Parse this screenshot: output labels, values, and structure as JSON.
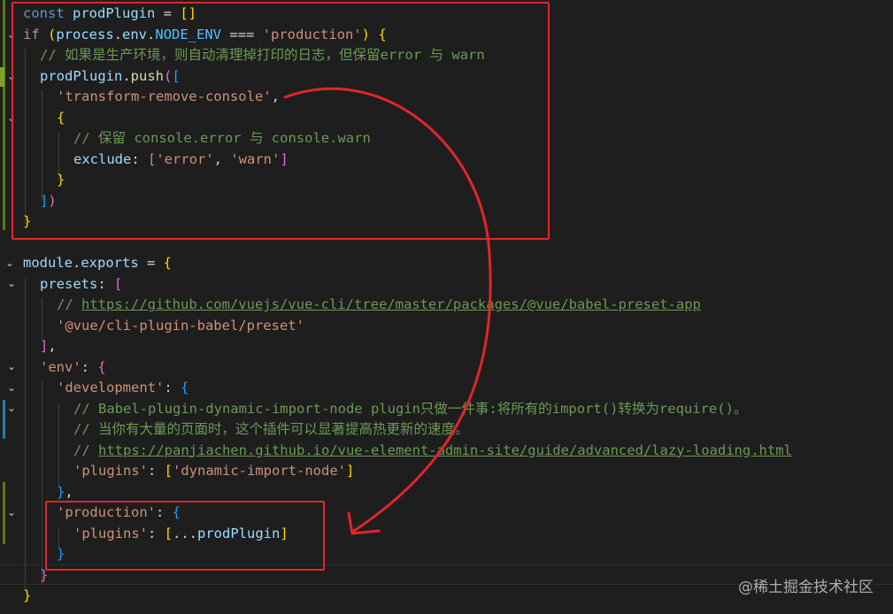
{
  "lines": [
    {
      "segments": [
        [
          "kw",
          "const "
        ],
        [
          "var",
          "prodPlugin"
        ],
        [
          "punc",
          " = "
        ],
        [
          "br1",
          "[]"
        ]
      ]
    },
    {
      "segments": [
        [
          "kw2",
          "if "
        ],
        [
          "br1",
          "("
        ],
        [
          "var",
          "process"
        ],
        [
          "punc",
          "."
        ],
        [
          "var",
          "env"
        ],
        [
          "punc",
          "."
        ],
        [
          "const",
          "NODE_ENV"
        ],
        [
          "punc",
          " === "
        ],
        [
          "str",
          "'production'"
        ],
        [
          "br1",
          ")"
        ],
        [
          "punc",
          " "
        ],
        [
          "br1",
          "{"
        ]
      ]
    },
    {
      "segments": [
        [
          "cm",
          "// 如果是生产环境，则自动清理掉打印的日志，但保留error 与 warn"
        ]
      ]
    },
    {
      "segments": [
        [
          "var",
          "prodPlugin"
        ],
        [
          "punc",
          "."
        ],
        [
          "fn",
          "push"
        ],
        [
          "br2",
          "("
        ],
        [
          "br3",
          "["
        ]
      ]
    },
    {
      "segments": [
        [
          "str",
          "'transform-remove-console'"
        ],
        [
          "punc",
          ","
        ]
      ]
    },
    {
      "segments": [
        [
          "br1",
          "{"
        ]
      ]
    },
    {
      "segments": [
        [
          "cm",
          "// 保留 console.error 与 console.warn"
        ]
      ]
    },
    {
      "segments": [
        [
          "var",
          "exclude"
        ],
        [
          "punc",
          ": "
        ],
        [
          "br2",
          "["
        ],
        [
          "str",
          "'error'"
        ],
        [
          "punc",
          ", "
        ],
        [
          "str",
          "'warn'"
        ],
        [
          "br2",
          "]"
        ]
      ]
    },
    {
      "segments": [
        [
          "br1",
          "}"
        ]
      ]
    },
    {
      "segments": [
        [
          "br3",
          "]"
        ],
        [
          "br2",
          ")"
        ]
      ]
    },
    {
      "segments": [
        [
          "br1",
          "}"
        ]
      ]
    },
    {
      "segments": []
    },
    {
      "segments": [
        [
          "var",
          "module"
        ],
        [
          "punc",
          "."
        ],
        [
          "var",
          "exports"
        ],
        [
          "punc",
          " = "
        ],
        [
          "br1",
          "{"
        ]
      ]
    },
    {
      "segments": [
        [
          "var",
          "presets"
        ],
        [
          "punc",
          ": "
        ],
        [
          "br2",
          "["
        ]
      ]
    },
    {
      "segments": [
        [
          "cm",
          "// "
        ],
        [
          "link",
          "https://github.com/vuejs/vue-cli/tree/master/packages/@vue/babel-preset-app"
        ]
      ]
    },
    {
      "segments": [
        [
          "str",
          "'@vue/cli-plugin-babel/preset'"
        ]
      ]
    },
    {
      "segments": [
        [
          "br2",
          "]"
        ],
        [
          "punc",
          ","
        ]
      ]
    },
    {
      "segments": [
        [
          "str",
          "'env'"
        ],
        [
          "punc",
          ": "
        ],
        [
          "br2",
          "{"
        ]
      ]
    },
    {
      "segments": [
        [
          "str",
          "'development'"
        ],
        [
          "punc",
          ": "
        ],
        [
          "br3",
          "{"
        ]
      ]
    },
    {
      "segments": [
        [
          "cm",
          "// Babel-plugin-dynamic-import-node plugin只做一件事:将所有的import()转换为require()。"
        ]
      ]
    },
    {
      "segments": [
        [
          "cm",
          "// 当你有大量的页面时，这个插件可以显著提高热更新的速度。"
        ]
      ]
    },
    {
      "segments": [
        [
          "cm",
          "// "
        ],
        [
          "link",
          "https://panjiachen.github.io/vue-element-admin-site/guide/advanced/lazy-loading.html"
        ]
      ]
    },
    {
      "segments": [
        [
          "str",
          "'plugins'"
        ],
        [
          "punc",
          ": "
        ],
        [
          "br1",
          "["
        ],
        [
          "str",
          "'dynamic-import-node'"
        ],
        [
          "br1",
          "]"
        ]
      ]
    },
    {
      "segments": [
        [
          "br3",
          "}"
        ],
        [
          "punc",
          ","
        ]
      ]
    },
    {
      "segments": [
        [
          "str",
          "'production'"
        ],
        [
          "punc",
          ": "
        ],
        [
          "br3",
          "{"
        ]
      ]
    },
    {
      "segments": [
        [
          "str",
          "'plugins'"
        ],
        [
          "punc",
          ": "
        ],
        [
          "br1",
          "["
        ],
        [
          "punc",
          "..."
        ],
        [
          "var",
          "prodPlugin"
        ],
        [
          "br1",
          "]"
        ]
      ]
    },
    {
      "segments": [
        [
          "br3",
          "}"
        ]
      ]
    },
    {
      "segments": [
        [
          "br2",
          "}"
        ]
      ]
    },
    {
      "segments": [
        [
          "br1",
          "}"
        ]
      ]
    }
  ],
  "watermark": "@稀土掘金技术社区",
  "colors": {
    "background": "#1e1e1e",
    "highlight_box": "#e0262a",
    "arrow": "#e0262a",
    "gutter_added": "#587c0c",
    "gutter_modified": "#1b81a8"
  }
}
